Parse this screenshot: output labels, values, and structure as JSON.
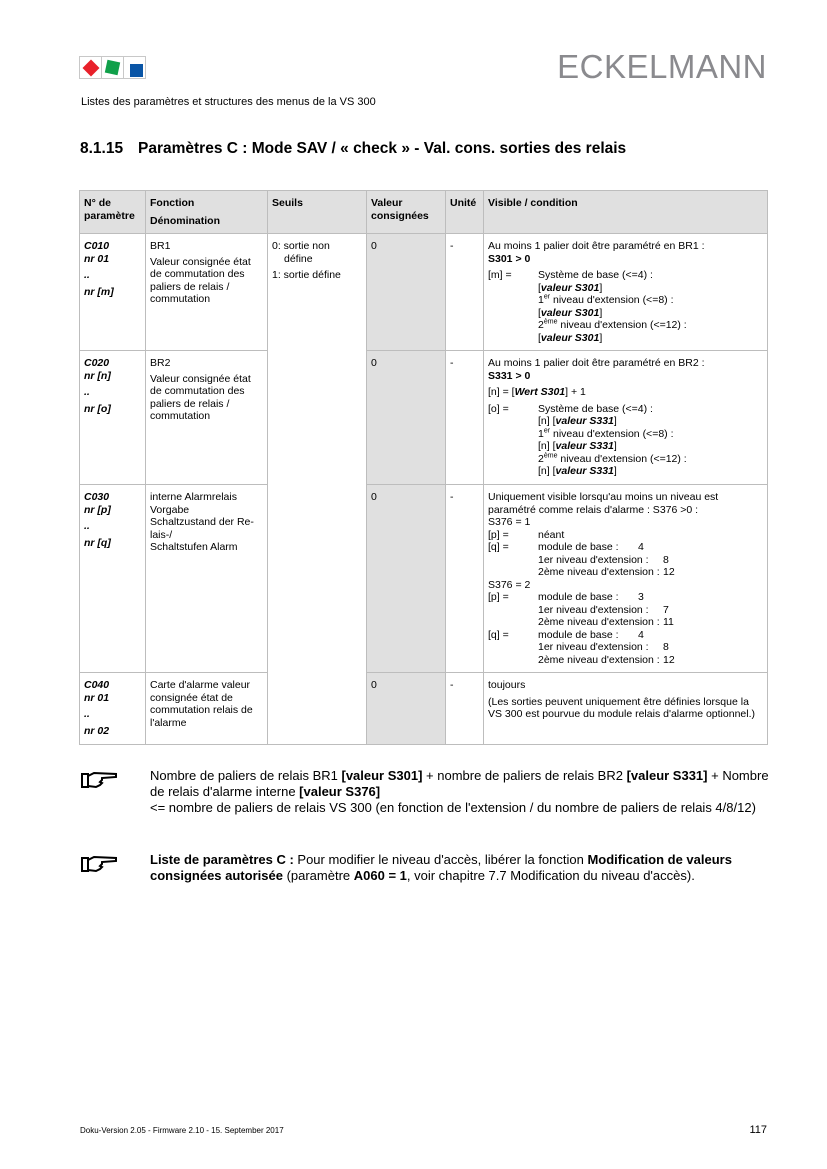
{
  "header": {
    "brand": "ECKELMANN",
    "subtitle": "Listes des paramètres et structures des menus de la VS 300",
    "logo_colors": {
      "red": "#e8202a",
      "green": "#10a04a",
      "blue": "#0a55a6"
    }
  },
  "section": {
    "number": "8.1.15",
    "title": "Paramètres C : Mode SAV / « check » - Val. cons. sorties des relais"
  },
  "table": {
    "headers": {
      "param": "N° de paramètre",
      "fonction": "Fonction",
      "denomination": "Dénomination",
      "seuils": "Seuils",
      "valeur": "Valeur consignées",
      "unite": "Unité",
      "visible": "Visible / condition"
    },
    "seuils": [
      "0: sortie non    define",
      "1: sortie défine"
    ],
    "seuils_a": "0: sortie non",
    "seuils_b": "défine",
    "seuils_c": "1: sortie défine",
    "rows": [
      {
        "param": [
          "C010",
          "nr 01",
          "..",
          "nr [m]"
        ],
        "fn_title": "BR1",
        "fn_text": "Valeur consignée état de commutation des paliers de relais / commutation",
        "valeur": "0",
        "unite": "-",
        "cond_intro": "Au moins 1 palier doit être paramétré en BR1 :",
        "cond_bold": "S301 > 0",
        "lbl": "[m] =",
        "lines": {
          "l1": "Système de base (<=4) :",
          "v": "valeur S301",
          "l2a": "1",
          "l2s": "er",
          "l2b": " niveau d'extension (<=8) :",
          "l3a": "2",
          "l3s": "ème",
          "l3b": " niveau d'extension (<=12) :"
        }
      },
      {
        "param": [
          "C020",
          "nr [n]",
          "..",
          "nr [o]"
        ],
        "fn_title": "BR2",
        "fn_text": "Valeur consignée état de commutation des paliers de relais / commutation",
        "valeur": "0",
        "unite": "-",
        "cond_intro": "Au moins 1 palier doit être paramétré en BR2 :",
        "cond_bold": "S331 > 0",
        "n_pre": "[n] = [",
        "n_bold": "Wert S301",
        "n_post": "] + 1",
        "lbl": "[o] =",
        "prefix": "[n] [",
        "lines": {
          "l1": "Système de base (<=4) :",
          "v": "valeur S331",
          "l2a": "1",
          "l2s": "er",
          "l2b": " niveau d'extension (<=8) :",
          "l3a": "2",
          "l3s": "ème",
          "l3b": " niveau d'extension (<=12) :"
        }
      },
      {
        "param": [
          "C030",
          "nr [p]",
          "..",
          "nr [q]"
        ],
        "fn_lines": [
          "interne Alarmrelais",
          "Vorgabe",
          "Schaltzustand der Re-",
          "lais-/",
          "Schaltstufen Alarm"
        ],
        "valeur": "0",
        "unite": "-",
        "cond_intro": "Uniquement visible lorsqu'au moins un niveau est paramétré comme relais d'alarme : S376 >0 :",
        "s1": "S376 = 1",
        "p_lbl": "[p] =",
        "q_lbl": "[q] =",
        "neant": "néant",
        "base": "module de base :",
        "ext1": "1er niveau d'extension :",
        "ext2": "2ème niveau d'extension :",
        "s1_q": [
          "4",
          "8",
          "12"
        ],
        "s2": "S376 = 2",
        "s2_p": [
          "3",
          "7",
          "11"
        ],
        "s2_q": [
          "4",
          "8",
          "12"
        ]
      },
      {
        "param": [
          "C040",
          "nr 01",
          "..",
          "nr 02"
        ],
        "fn_text": "Carte d'alarme valeur consignée état de commutation relais de l'alarme",
        "valeur": "0",
        "unite": "-",
        "cond_1": "toujours",
        "cond_2": "(Les sorties peuvent uniquement être définies lorsque la VS 300 est pourvue du module relais d'alarme optionnel.)"
      }
    ]
  },
  "notes": [
    {
      "icon": "pointing-hand-icon",
      "t1": "Nombre de paliers de relais BR1 ",
      "b1": "[valeur S301]",
      "t2": " + nombre de paliers de relais BR2 ",
      "b2": "[valeur S331]",
      "t3": " + Nombre de relais d'alarme interne ",
      "b3": "[valeur S376]",
      "t4": "<= nombre de paliers de relais VS 300 (en fonction de l'extension / du nombre de paliers de relais 4/8/12)"
    },
    {
      "icon": "pointing-hand-icon",
      "b1": "Liste de paramètres C :",
      "t1": " Pour modifier le niveau d'accès, libérer la fonction ",
      "b2": "Modification de valeurs consignées autorisée",
      "t2": " (paramètre ",
      "b3": "A060 = 1",
      "t3": ", voir chapitre 7.7 Modification du niveau d'accès)."
    }
  ],
  "footer": {
    "doc_version": "Doku-Version 2.05 - Firmware 2.10 - 15. September 2017",
    "page": "117"
  }
}
